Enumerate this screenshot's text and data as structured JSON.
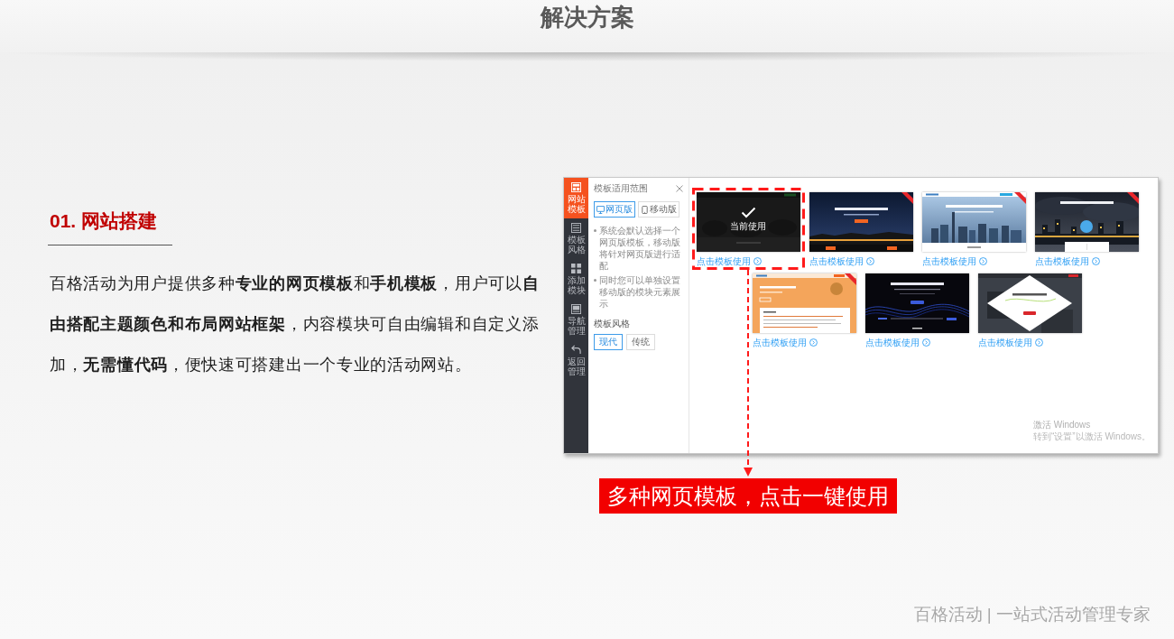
{
  "header": {
    "title": "解决方案"
  },
  "section": {
    "heading": "01. 网站搭建",
    "paragraph": "百格活动为用户提供多种**专业的网页模板**和**手机模板**，用户可以**自由搭配主题颜色和布局网站框架**，内容模块可自由编辑和自定义添加，**无需懂代码**，便快速可搭建出一个专业的活动网站。"
  },
  "screenshot": {
    "sidebar": {
      "items": [
        {
          "label": "网站模板",
          "selected": true
        },
        {
          "label": "模板风格",
          "selected": false
        },
        {
          "label": "添加模块",
          "selected": false
        },
        {
          "label": "导航管理",
          "selected": false
        },
        {
          "label": "返回管理",
          "selected": false
        }
      ]
    },
    "panel": {
      "title": "模板适用范围",
      "device_tabs": [
        {
          "label": "网页版",
          "selected": true
        },
        {
          "label": "移动版",
          "selected": false
        }
      ],
      "notes": [
        "系统会默认选择一个网页版模板，移动版将针对网页版进行适配",
        "同时您可以单独设置移动版的模块元素展示"
      ],
      "style_label": "模板风格",
      "style_options": [
        {
          "label": "现代",
          "selected": true
        },
        {
          "label": "传统",
          "selected": false
        }
      ]
    },
    "templates": {
      "selected_label": "当前使用",
      "items": [
        {
          "kind": "crowd",
          "selected": true,
          "highlighted": true,
          "ribbon": false,
          "link": "点击模板使用"
        },
        {
          "kind": "night",
          "selected": false,
          "highlighted": false,
          "ribbon": true,
          "link": "点击模板使用"
        },
        {
          "kind": "skyline",
          "selected": false,
          "highlighted": false,
          "ribbon": true,
          "link": "点击模板使用"
        },
        {
          "kind": "storm",
          "selected": false,
          "highlighted": false,
          "ribbon": true,
          "link": "点击模板使用"
        },
        {
          "kind": "orange",
          "selected": false,
          "highlighted": false,
          "ribbon": true,
          "link": "点击模板使用"
        },
        {
          "kind": "wave",
          "selected": false,
          "highlighted": false,
          "ribbon": false,
          "link": "点击模板使用"
        },
        {
          "kind": "diamond",
          "selected": false,
          "highlighted": false,
          "ribbon": false,
          "link": "点击模板使用"
        }
      ]
    },
    "activation_notice": {
      "title": "激活 Windows",
      "hint": "转到“设置”以激活 Windows。"
    }
  },
  "callout": "多种网页模板，点击一键使用",
  "footer": "百格活动 | 一站式活动管理专家"
}
